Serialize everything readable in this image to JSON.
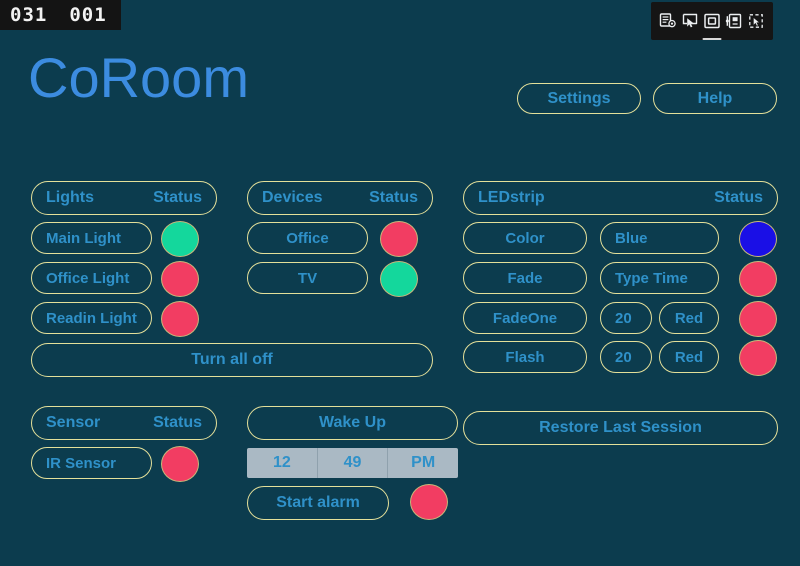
{
  "overlay": {
    "frame_counter_left": "031",
    "frame_counter_right": "001",
    "toolbar_icons": [
      "layout-inspector-icon",
      "pointer-select-icon",
      "bounding-box-icon",
      "layout-bounds-icon",
      "pointer-bounds-icon"
    ]
  },
  "header": {
    "title": "CoRoom",
    "settings_label": "Settings",
    "help_label": "Help"
  },
  "lights": {
    "header_name": "Lights",
    "header_status": "Status",
    "items": [
      {
        "label": "Main Light",
        "status": "green"
      },
      {
        "label": "Office Light",
        "status": "red"
      },
      {
        "label": "Readin Light",
        "status": "red"
      }
    ],
    "turn_all_off_label": "Turn all off"
  },
  "devices": {
    "header_name": "Devices",
    "header_status": "Status",
    "items": [
      {
        "label": "Office",
        "status": "red"
      },
      {
        "label": "TV",
        "status": "green"
      }
    ]
  },
  "ledstrip": {
    "header_name": "LEDstrip",
    "header_status": "Status",
    "rows": [
      {
        "action": "Color",
        "value": "Blue",
        "extra": "",
        "status": "blue"
      },
      {
        "action": "Fade",
        "value": "Type Time",
        "extra": "",
        "status": "red"
      },
      {
        "action": "FadeOne",
        "value": "20",
        "extra": "Red",
        "status": "red"
      },
      {
        "action": "Flash",
        "value": "20",
        "extra": "Red",
        "status": "red"
      }
    ],
    "restore_label": "Restore Last Session"
  },
  "sensor": {
    "header_name": "Sensor",
    "header_status": "Status",
    "items": [
      {
        "label": "IR  Sensor",
        "status": "red"
      }
    ]
  },
  "alarm": {
    "wake_up_label": "Wake Up",
    "hour": "12",
    "minute": "49",
    "meridiem": "PM",
    "start_label": "Start alarm",
    "status": "red"
  },
  "colors": {
    "background": "#0c3c4e",
    "pill_border": "#e4e09a",
    "text_blue": "#2f91c9",
    "title_blue": "#3c8ce0",
    "status_green": "#14d79c",
    "status_red": "#f23d62",
    "status_blue": "#1a0fe6",
    "timepicker_bg": "#aab9c4"
  }
}
